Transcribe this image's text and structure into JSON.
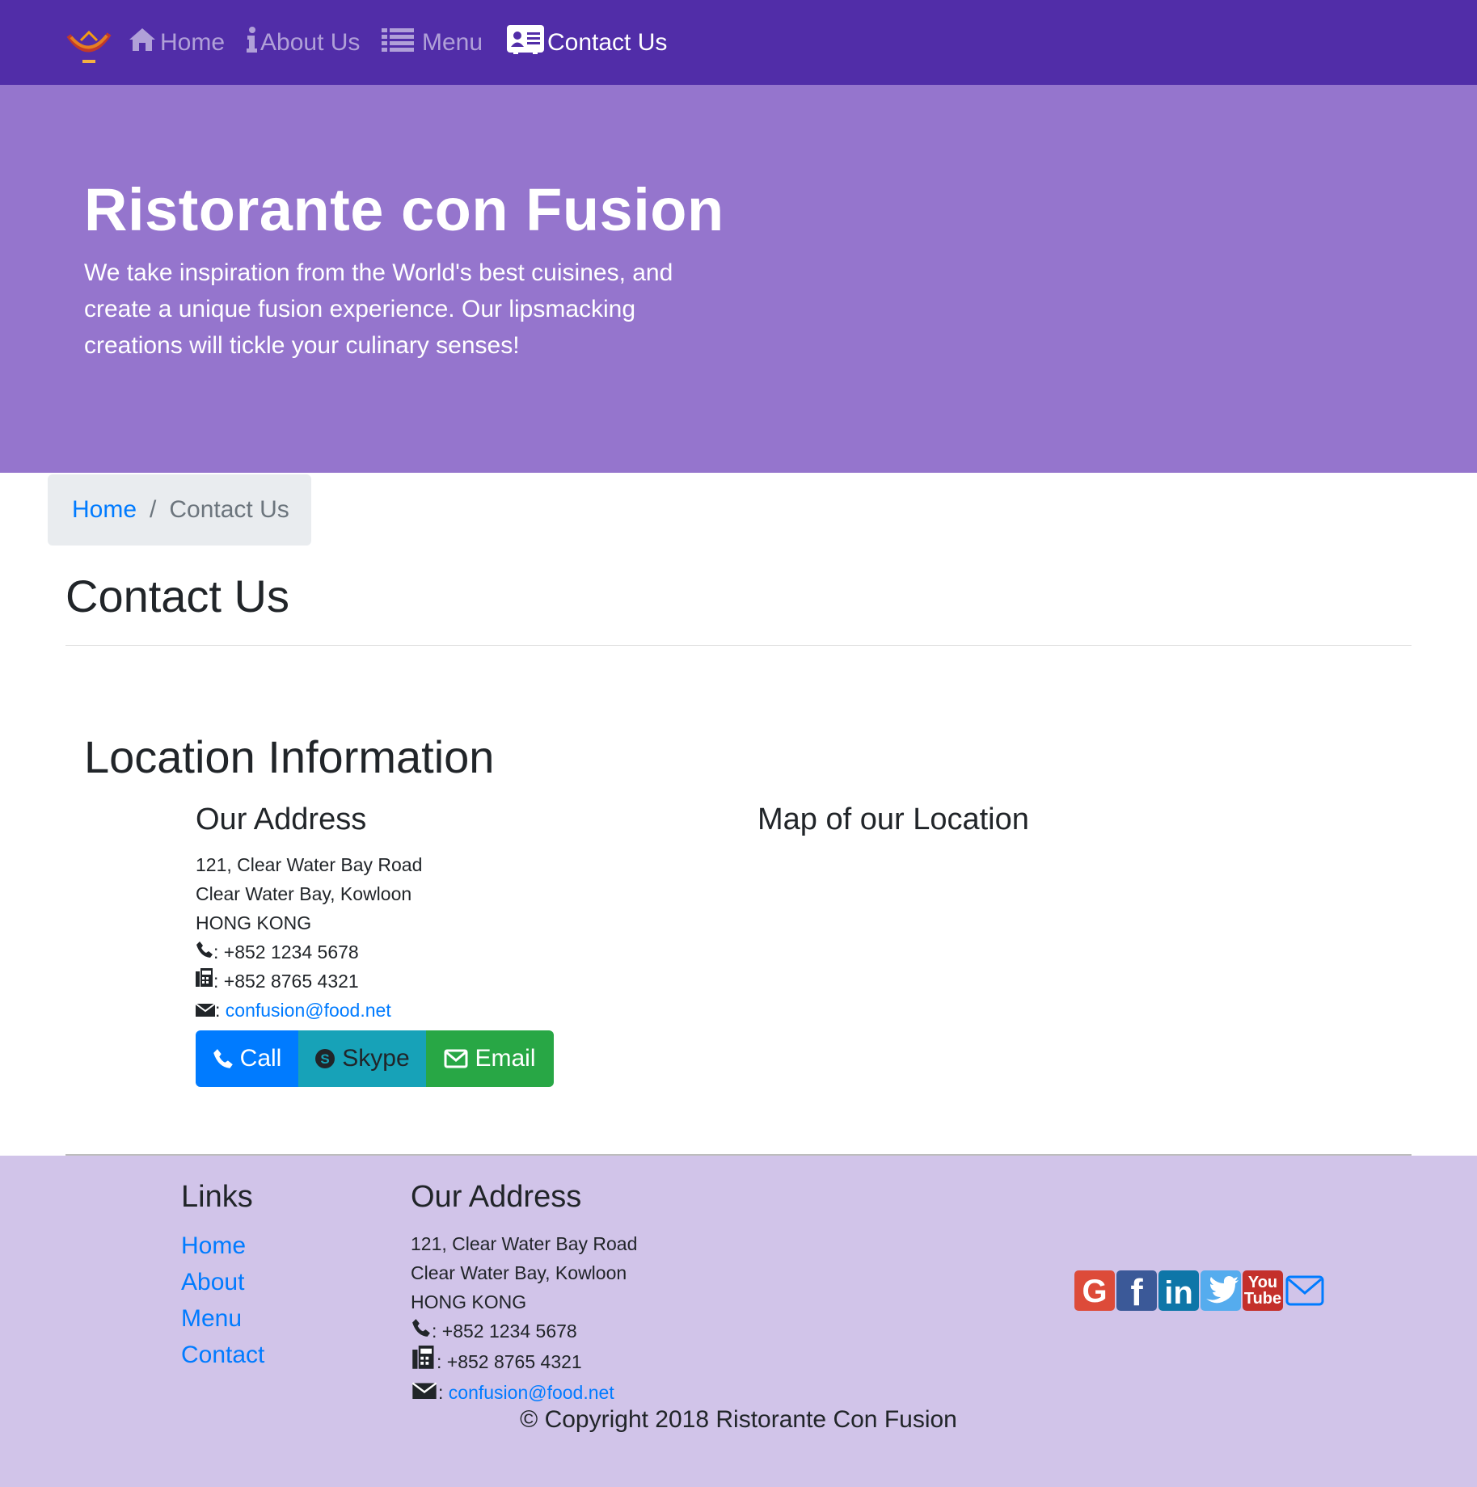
{
  "nav": {
    "items": [
      {
        "label": "Home",
        "icon": "home-icon"
      },
      {
        "label": "About Us",
        "icon": "info-icon"
      },
      {
        "label": "Menu",
        "icon": "list-icon"
      },
      {
        "label": "Contact Us",
        "icon": "address-card-icon",
        "active": true
      }
    ]
  },
  "jumbotron": {
    "title": "Ristorante con Fusion",
    "text": "We take inspiration from the World's best cuisines, and create a unique fusion experience. Our lipsmacking creations will tickle your culinary senses!"
  },
  "breadcrumb": {
    "home": "Home",
    "separator": "/",
    "current": "Contact Us"
  },
  "page_title": "Contact Us",
  "location": {
    "title": "Location Information",
    "address_title": "Our Address",
    "map_title": "Map of our Location",
    "address_lines": [
      "121, Clear Water Bay Road",
      "Clear Water Bay, Kowloon",
      "HONG KONG"
    ],
    "phone": "+852 1234 5678",
    "fax": "+852 8765 4321",
    "email": "confusion@food.net",
    "sep": ":"
  },
  "buttons": {
    "call": "Call",
    "skype": "Skype",
    "email": "Email"
  },
  "footer": {
    "links_title": "Links",
    "links": [
      "Home",
      "About",
      "Menu",
      "Contact"
    ],
    "address_title": "Our Address",
    "address_lines": [
      "121, Clear Water Bay Road",
      "Clear Water Bay, Kowloon",
      "HONG KONG"
    ],
    "phone": "+852 1234 5678",
    "fax": "+852 8765 4321",
    "email": "confusion@food.net",
    "social": [
      "google-plus-icon",
      "facebook-icon",
      "linkedin-icon",
      "twitter-icon",
      "youtube-icon",
      "envelope-icon"
    ],
    "youtube_text": [
      "You",
      "Tube"
    ],
    "copyright": "© Copyright 2018 Ristorante Con Fusion"
  },
  "colors": {
    "navbar": "#512DA8",
    "jumbotron": "#9575CD",
    "footer": "#D1C4E9",
    "link": "#007bff"
  }
}
